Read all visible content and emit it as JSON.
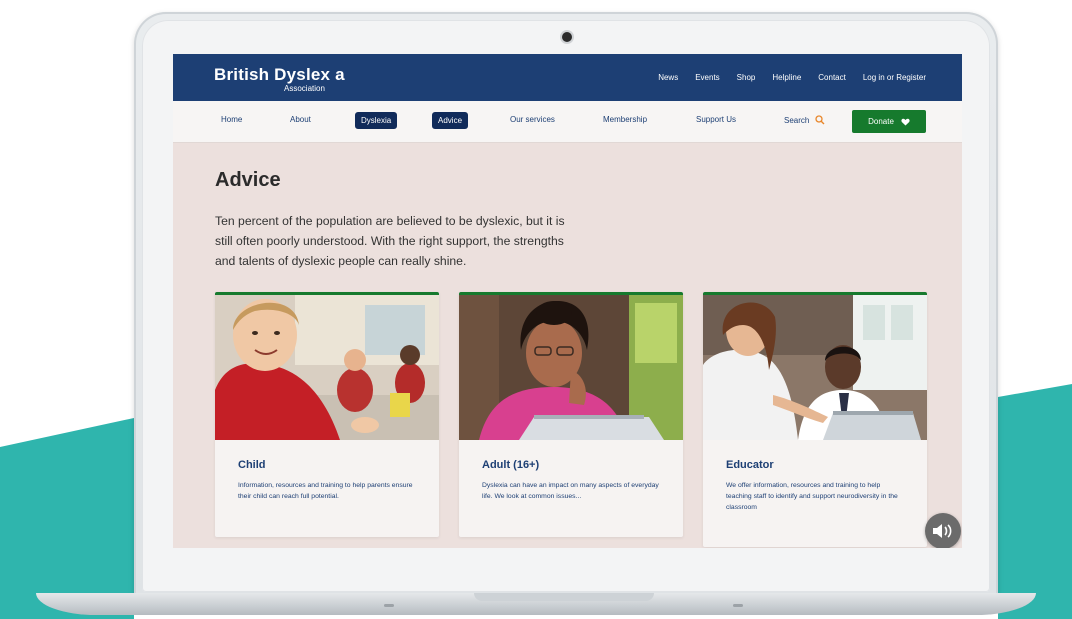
{
  "site": {
    "logo_main": "British Dyslex a",
    "logo_sub": "Association"
  },
  "top_links": [
    "News",
    "Events",
    "Shop",
    "Helpline",
    "Contact",
    "Log in or Register"
  ],
  "nav": {
    "home": "Home",
    "about": "About",
    "dyslexia": "Dyslexia",
    "advice": "Advice",
    "our_services": "Our services",
    "membership": "Membership",
    "support_us": "Support Us",
    "search": "Search",
    "donate": "Donate"
  },
  "page": {
    "title": "Advice",
    "intro": "Ten percent of the population are believed to be dyslexic, but it is still often poorly understood. With the right support, the strengths and talents of dyslexic people can really shine."
  },
  "cards": [
    {
      "title": "Child",
      "desc": "Information, resources and training to help parents ensure their child can reach full potential."
    },
    {
      "title": "Adult (16+)",
      "desc": "Dyslexia can have an impact on many aspects of everyday life. We look at common issues..."
    },
    {
      "title": "Educator",
      "desc": "We offer information, resources and training to help teaching staff to identify and support neurodiversity in the classroom"
    }
  ],
  "colors": {
    "navy": "#1d3f74",
    "green": "#167a2d",
    "teal": "#2fb5ad",
    "page_bg": "#ece0dd"
  },
  "icons": {
    "search": "search-icon",
    "donate": "heart-icon",
    "audio": "speaker-icon",
    "camera": "camera-icon"
  }
}
